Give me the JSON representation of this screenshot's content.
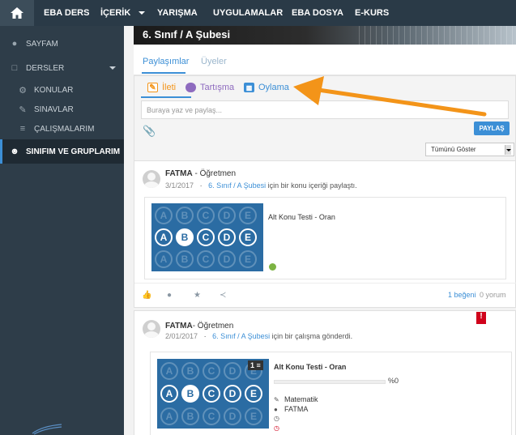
{
  "topnav": {
    "items": [
      "EBA DERS",
      "İÇERİK",
      "YARIŞMA",
      "UYGULAMALAR",
      "EBA DOSYA",
      "E-KURS"
    ]
  },
  "sidebar": {
    "items": [
      {
        "label": "SAYFAM",
        "icon": "user-icon"
      },
      {
        "label": "DERSLER",
        "icon": "book-icon"
      },
      {
        "label": "KONULAR",
        "icon": "gear-icon"
      },
      {
        "label": "SINAVLAR",
        "icon": "pencil-icon"
      },
      {
        "label": "ÇALIŞMALARIM",
        "icon": "list-icon"
      },
      {
        "label": "SINIFIM VE GRUPLARIM",
        "icon": "group-icon"
      }
    ]
  },
  "banner": {
    "title": "6. Sınıf / A Şubesi"
  },
  "tabs": [
    "Paylaşımlar",
    "Üyeler"
  ],
  "composer": {
    "types": [
      "İleti",
      "Tartışma",
      "Oylama"
    ],
    "placeholder": "Buraya yaz ve paylaş...",
    "share_label": "PAYLAŞ"
  },
  "filter": {
    "selected": "Tümünü Göster"
  },
  "posts": [
    {
      "author": "FATMA",
      "role": " - Öğretmen",
      "date": "3/1/2017",
      "sep": "·",
      "group": "6. Sınıf / A Şubesi",
      "action": " için bir konu içeriği paylaştı.",
      "card_title": "Alt Konu Testi - Oran",
      "likes": "1 beğeni",
      "comments": "0 yorum"
    },
    {
      "author": "FATMA",
      "role": "- Öğretmen",
      "date": "2/01/2017",
      "sep": "·",
      "group": "6. Sınıf / A Şubesi",
      "action": " için bir çalışma gönderdi.",
      "card_title": "Alt Konu Testi - Oran",
      "percent": "%0",
      "progress": 0,
      "subject": "Matematik",
      "teacher": "FATMA",
      "count": "1",
      "flag": "!"
    }
  ],
  "quiz_letters": [
    "A",
    "B",
    "C",
    "D",
    "E"
  ],
  "colors": {
    "accent": "#3c8fd6",
    "arrow": "#f39419",
    "nav": "#2a3a47"
  }
}
